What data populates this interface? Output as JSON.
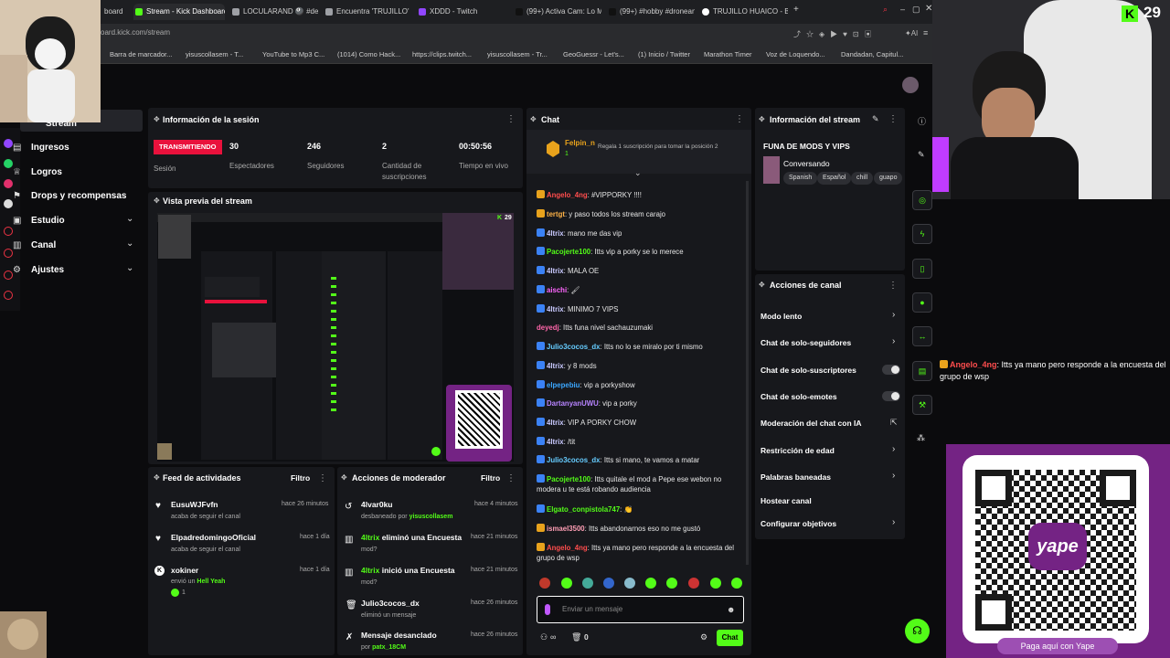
{
  "browser": {
    "tabs": [
      {
        "title": "board"
      },
      {
        "title": "Stream - Kick Dashboard"
      },
      {
        "title": "LOCULARAND 🎱 #de"
      },
      {
        "title": "Encuentra 'TRUJILLO' en"
      },
      {
        "title": "XDDD - Twitch"
      },
      {
        "title": "(99+) Activa Cam: Lo Mejo"
      },
      {
        "title": "(99+) #hobby #droneando"
      },
      {
        "title": "TRUJILLO HUAICO - Busc"
      }
    ],
    "url": "oard.kick.com/stream",
    "bookmarks": [
      "Barra de marcador...",
      "yisuscollasem - T...",
      "YouTube to Mp3 C...",
      "(1014) Como Hack...",
      "https://clips.twitch...",
      "yisuscollasem - Tr...",
      "GeoGuessr - Let's...",
      "(1) Inicio / Twitter",
      "Marathon Timer",
      "Voz de Loquendo...",
      "Dandadan, Capitul..."
    ]
  },
  "nav": {
    "partial_item": "Stream",
    "items": [
      {
        "label": "Ingresos",
        "has_chevron": false
      },
      {
        "label": "Logros",
        "has_chevron": false
      },
      {
        "label": "Drops y recompensas",
        "has_chevron": false
      },
      {
        "label": "Estudio",
        "has_chevron": true
      },
      {
        "label": "Canal",
        "has_chevron": true
      },
      {
        "label": "Ajustes",
        "has_chevron": true
      }
    ],
    "chevron": "⌄"
  },
  "session": {
    "title": "Información de la sesión",
    "live_badge": "TRANSMITIENDO",
    "live_label": "Sesión",
    "stats": [
      {
        "value": "30",
        "label": "Espectadores"
      },
      {
        "value": "246",
        "label": "Seguidores"
      },
      {
        "value": "2",
        "label": "Cantidad de suscripciones"
      },
      {
        "value": "00:50:56",
        "label": "Tiempo en vivo"
      }
    ]
  },
  "preview": {
    "title": "Vista previa del stream",
    "viewer_count": "29"
  },
  "chat": {
    "title": "Chat",
    "pinned_user": "Felpin_n",
    "pinned_sub": "1",
    "pinned_promo": "Regala 1 suscripción para tomar la posición 2",
    "messages": [
      {
        "user": "Angelo_4ng",
        "text": "#VIPPORKY !!!!",
        "color": "#ff4d4d",
        "badge": "#e8a21c"
      },
      {
        "user": "tertgt",
        "text": "y paso todos los stream carajo",
        "color": "#ffb347",
        "badge": "#e8a21c"
      },
      {
        "user": "4ltrix",
        "text": "mano me das vip",
        "color": "#c9c9ff",
        "badge": "#3b82f6"
      },
      {
        "user": "Pacojerte100",
        "text": "Itts vip a porky se lo merece",
        "color": "#53fc18",
        "badge": "#3b82f6"
      },
      {
        "user": "4ltrix",
        "text": "MALA OE",
        "color": "#c9c9ff",
        "badge": "#3b82f6"
      },
      {
        "user": "aischi",
        "text": "🖌",
        "color": "#ff66ff",
        "badge": "#3b82f6"
      },
      {
        "user": "4ltrix",
        "text": "MINIMO 7 VIPS",
        "color": "#c9c9ff",
        "badge": "#3b82f6"
      },
      {
        "user": "deyedj",
        "text": "Itts funa nivel sachauzumaki",
        "color": "#ff66aa",
        "badge": ""
      },
      {
        "user": "Julio3cocos_dx",
        "text": "Itts no lo se miralo por ti mismo",
        "color": "#66ccff",
        "badge": "#3b82f6"
      },
      {
        "user": "4ltrix",
        "text": "y 8 mods",
        "color": "#c9c9ff",
        "badge": "#3b82f6"
      },
      {
        "user": "elpepebiu",
        "text": "vip a porkyshow",
        "color": "#3ba7ff",
        "badge": "#3b82f6"
      },
      {
        "user": "DartanyanUWU",
        "text": "vip a porky",
        "color": "#b784ff",
        "badge": "#3b82f6"
      },
      {
        "user": "4ltrix",
        "text": "VIP A PORKY CHOW",
        "color": "#c9c9ff",
        "badge": "#3b82f6"
      },
      {
        "user": "4ltrix",
        "text": "/tit",
        "color": "#c9c9ff",
        "badge": "#3b82f6"
      },
      {
        "user": "Julio3cocos_dx",
        "text": "Itts si mano, te vamos a matar",
        "color": "#66ccff",
        "badge": "#3b82f6"
      },
      {
        "user": "Pacojerte100",
        "text": "Itts quitale el mod a Pepe ese webon no modera u te está robando audiencia",
        "color": "#53fc18",
        "badge": "#3b82f6"
      },
      {
        "user": "Elgato_conpistola747",
        "text": "👏",
        "color": "#53fc18",
        "badge": "#3b82f6"
      },
      {
        "user": "ismael3500",
        "text": "Itts abandonarnos eso no me gustó",
        "color": "#ff9eb5",
        "badge": "#e8a21c"
      },
      {
        "user": "Angelo_4ng",
        "text": "Itts ya mano pero responde a la encuesta del grupo de wsp",
        "color": "#ff4d4d",
        "badge": "#e8a21c"
      }
    ],
    "input_placeholder": "Enviar un mensaje",
    "send_label": "Chat",
    "footer_count": "0",
    "infinity": "∞"
  },
  "stream_info": {
    "title": "Información del stream",
    "stream_title": "FUNA DE MODS Y VIPS",
    "category": "Conversando",
    "tags": [
      "Spanish",
      "Español",
      "chill",
      "guapo"
    ]
  },
  "channel_actions": {
    "title": "Acciones de canal",
    "items": [
      {
        "label": "Modo lento",
        "control": "chevron"
      },
      {
        "label": "Chat de solo-seguidores",
        "control": "chevron"
      },
      {
        "label": "Chat de solo-suscriptores",
        "control": "toggle"
      },
      {
        "label": "Chat de solo-emotes",
        "control": "toggle"
      },
      {
        "label": "Moderación del chat con IA",
        "control": "external"
      },
      {
        "label": "Restricción de edad",
        "control": "chevron"
      },
      {
        "label": "Palabras baneadas",
        "control": "chevron"
      },
      {
        "label": "Hostear canal",
        "control": "none"
      },
      {
        "label": "Configurar objetivos",
        "control": "chevron"
      }
    ]
  },
  "activity_feed": {
    "title": "Feed de actividades",
    "filter_label": "Filtro",
    "items": [
      {
        "name": "EusuWJFvfn",
        "sub": "acaba de seguir el canal",
        "time": "hace 26 minutos",
        "extra": ""
      },
      {
        "name": "ElpadredomingoOficial",
        "sub": "acaba de seguir el canal",
        "time": "hace 1 día",
        "extra": ""
      },
      {
        "name": "xokiner",
        "sub": "envió un",
        "highlight": "Hell Yeah",
        "time": "hace 1 día",
        "extra": "1"
      }
    ]
  },
  "mod_actions": {
    "title": "Acciones de moderador",
    "filter_label": "Filtro",
    "items": [
      {
        "name": "4lvar0ku",
        "sub": "desbaneado por",
        "by": "yisuscollasem",
        "time": "hace 4 minutos"
      },
      {
        "name": "4ltrix",
        "suffix": "eliminó una Encuesta",
        "sub": "mod?",
        "by": "",
        "time": "hace 21 minutos"
      },
      {
        "name": "4ltrix",
        "suffix": "inició una Encuesta",
        "sub": "mod?",
        "by": "",
        "time": "hace 21 minutos"
      },
      {
        "name": "Julio3cocos_dx",
        "sub": "eliminó un mensaje",
        "by": "",
        "time": "hace 26 minutos"
      },
      {
        "name": "Mensaje desanclado",
        "sub": "por",
        "by": "patx_18CM",
        "time": "hace 26 minutos"
      }
    ]
  },
  "overlay": {
    "kick_count": "29",
    "chat_overlay_user": "Angelo_4ng",
    "chat_overlay_text": "Itts ya mano pero responde a la encuesta del grupo de wsp",
    "yape_label": "Paga aquí con Yape",
    "yape_brand": "yape"
  },
  "colors": {
    "kick_green": "#53fc18",
    "live_red": "#e9113c",
    "yape_purple": "#742384"
  }
}
